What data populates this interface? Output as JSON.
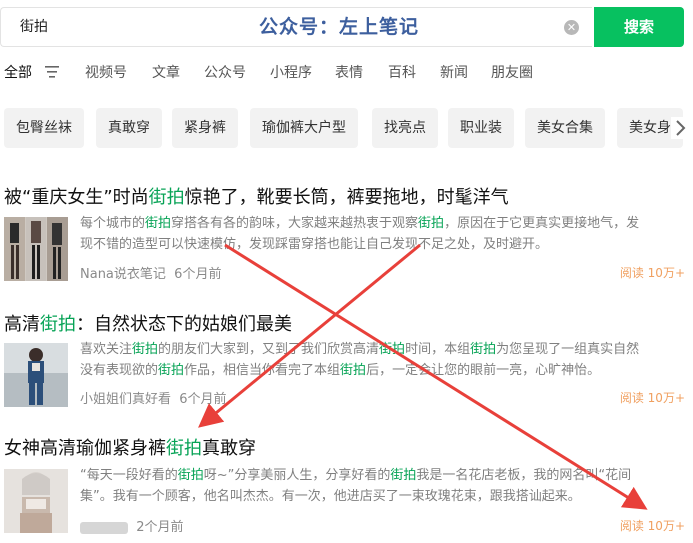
{
  "search": {
    "query": "街拍",
    "watermark": "公众号：左上笔记",
    "button_label": "搜索",
    "clear_icon": "clear-circle-icon"
  },
  "tabs": [
    {
      "label": "全部",
      "active": true
    },
    {
      "label": "视频号",
      "active": false
    },
    {
      "label": "文章",
      "active": false
    },
    {
      "label": "公众号",
      "active": false
    },
    {
      "label": "小程序",
      "active": false
    },
    {
      "label": "表情",
      "active": false
    },
    {
      "label": "百科",
      "active": false
    },
    {
      "label": "新闻",
      "active": false
    },
    {
      "label": "朋友圈",
      "active": false
    }
  ],
  "chips": [
    "包臀丝袜",
    "真敢穿",
    "紧身裤",
    "瑜伽裤大户型",
    "找亮点",
    "职业装",
    "美女合集",
    "美女身"
  ],
  "results": [
    {
      "title_pre": "被“重庆女生”时尚",
      "title_hl": "街拍",
      "title_post": "惊艳了，靴要长筒，裤要拖地，时髦洋气",
      "snippet_line1_pre": "每个城市的",
      "snippet_line1_hl": "街拍",
      "snippet_line1_mid": "穿搭各有各的韵味，大家越来越热衷于观察",
      "snippet_line1_hl2": "街拍",
      "snippet_line1_post": "，原因在于它更真实更接地气，发",
      "snippet_line2": "现不错的造型可以快速模仿，发现踩雷穿搭也能让自己发现不足之处，及时避开。",
      "source": "Nana说衣笔记",
      "time": "6个月前",
      "reads": "阅读 10万+"
    },
    {
      "title_pre": "高清",
      "title_hl": "街拍",
      "title_post": "：自然状态下的姑娘们最美",
      "snippet_line1_pre": "喜欢关注",
      "snippet_line1_hl": "街拍",
      "snippet_line1_mid": "的朋友们大家到，又到了我们欣赏高清",
      "snippet_line1_hl2": "街拍",
      "snippet_line1_post": "时间，本组",
      "snippet_line1_hl3": "街拍",
      "snippet_line1_post2": "为您呈现了一组真实自然",
      "snippet_line2_pre": "没有表现欲的",
      "snippet_line2_hl": "街拍",
      "snippet_line2_mid": "作品，相信当你看完了本组",
      "snippet_line2_hl2": "街拍",
      "snippet_line2_post": "后，一定会让您的眼前一亮，心旷神怡。",
      "source": "小姐姐们真好看",
      "time": "6个月前",
      "reads": "阅读 10万+"
    },
    {
      "title_pre": "女神高清瑜伽紧身裤",
      "title_hl": "街拍",
      "title_post": "真敢穿",
      "snippet_line1_pre": "“每天一段好看的",
      "snippet_line1_hl": "街拍",
      "snippet_line1_mid": "呀~”分享美丽人生，分享好看的",
      "snippet_line1_hl2": "街拍",
      "snippet_line1_post": "我是一名花店老板，我的网名叫“花间",
      "snippet_line2": "集”。我有一个顾客，他名叫杰杰。有一次，他进店买了一束玫瑰花束，跟我搭讪起来。",
      "source": "",
      "time": "2个月前",
      "reads": "阅读 10万+"
    }
  ],
  "colors": {
    "accent": "#07c160",
    "highlight": "#07a356",
    "reads": "#f0a060",
    "annotation_arrow": "#e8403a"
  }
}
